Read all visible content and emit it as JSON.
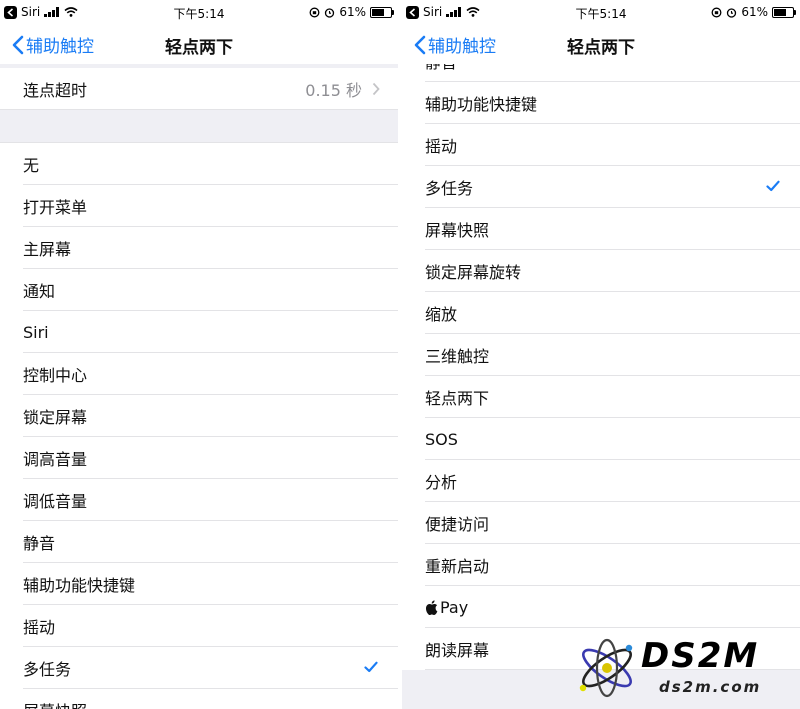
{
  "status_bar": {
    "carrier": "Siri",
    "time": "下午5:14",
    "battery": "61%",
    "battery_level": 0.61
  },
  "nav": {
    "back_label": "辅助触控",
    "title": "轻点两下"
  },
  "left": {
    "timeout_row": {
      "label": "连点超时",
      "value": "0.15 秒"
    },
    "items": [
      {
        "label": "无"
      },
      {
        "label": "打开菜单"
      },
      {
        "label": "主屏幕"
      },
      {
        "label": "通知"
      },
      {
        "label": "Siri"
      },
      {
        "label": "控制中心"
      },
      {
        "label": "锁定屏幕"
      },
      {
        "label": "调高音量"
      },
      {
        "label": "调低音量"
      },
      {
        "label": "静音"
      },
      {
        "label": "辅助功能快捷键"
      },
      {
        "label": "摇动"
      },
      {
        "label": "多任务",
        "selected": true
      },
      {
        "label": "屏幕快照"
      }
    ]
  },
  "right": {
    "partial_top": "静音",
    "items": [
      {
        "label": "辅助功能快捷键"
      },
      {
        "label": "摇动"
      },
      {
        "label": "多任务",
        "selected": true
      },
      {
        "label": "屏幕快照"
      },
      {
        "label": "锁定屏幕旋转"
      },
      {
        "label": "缩放"
      },
      {
        "label": "三维触控"
      },
      {
        "label": "轻点两下"
      },
      {
        "label": "SOS"
      },
      {
        "label": "分析"
      },
      {
        "label": "便捷访问"
      },
      {
        "label": "重新启动"
      },
      {
        "label": "Pay"
      },
      {
        "label": "朗读屏幕"
      }
    ]
  },
  "watermark": {
    "brand": "DS2M",
    "domain": "ds2m.com"
  },
  "colors": {
    "accent": "#1a7cf5",
    "group_bg": "#efeff4",
    "secondary_text": "#8e8e93"
  }
}
